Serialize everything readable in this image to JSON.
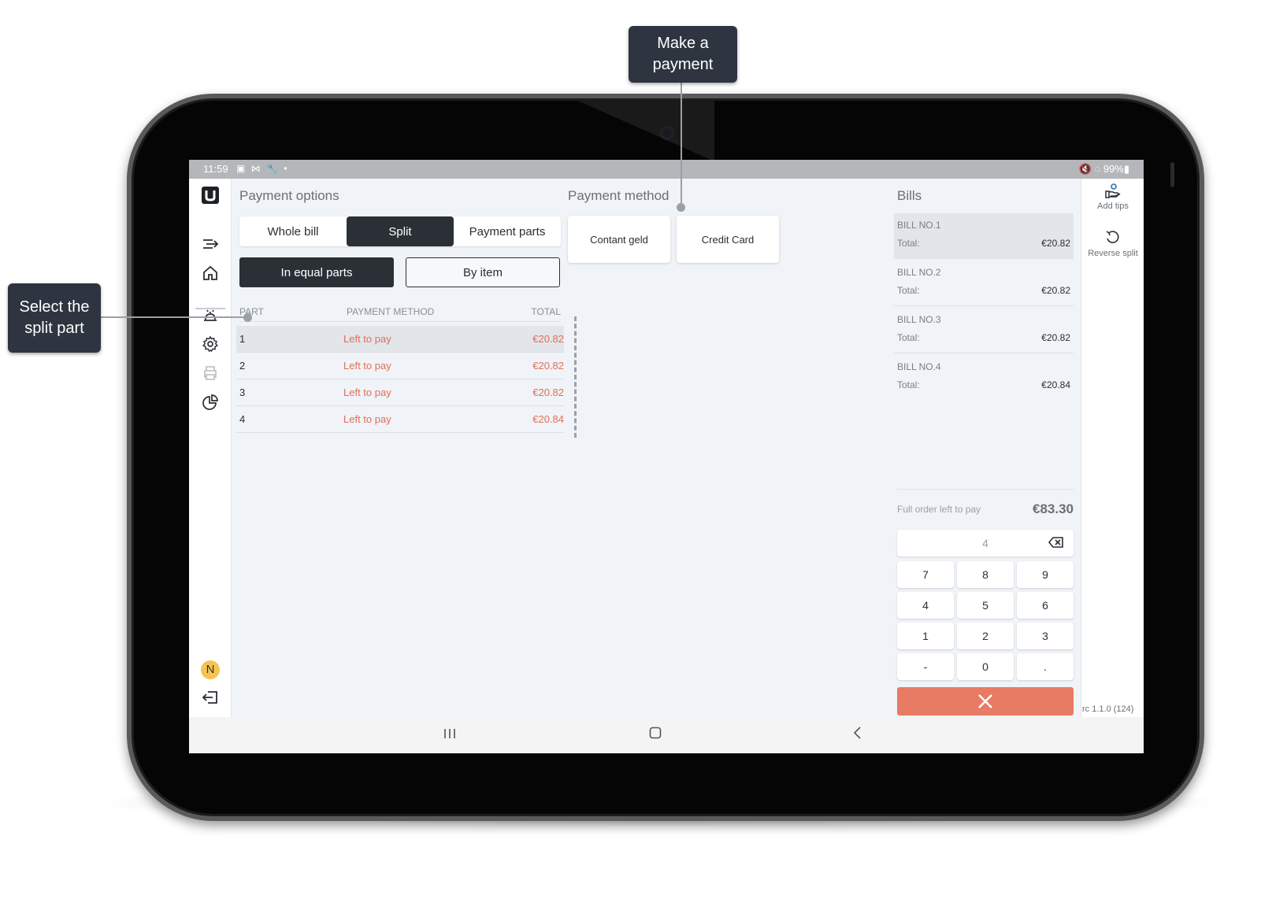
{
  "statusbar": {
    "time": "11:59",
    "left_icons": "▣ ⋈ 🔧 •",
    "right": "🔇 ◌ 99%▮"
  },
  "nav": {
    "icons": [
      "logo-icon",
      "collapse-icon",
      "home-icon",
      "service-bell-icon",
      "settings-icon",
      "print-icon",
      "reports-icon",
      "logout-icon"
    ],
    "avatar_initial": "N"
  },
  "payment_options": {
    "title": "Payment options",
    "tabs": [
      {
        "label": "Whole bill",
        "active": false
      },
      {
        "label": "Split",
        "active": true
      },
      {
        "label": "Payment parts",
        "active": false
      }
    ],
    "split_modes": {
      "equal": "In equal parts",
      "by_item": "By item"
    },
    "table": {
      "headers": {
        "part": "PART",
        "method": "PAYMENT METHOD",
        "total": "TOTAL"
      },
      "rows": [
        {
          "part": "1",
          "method": "Left to pay",
          "total": "€20.82",
          "selected": true
        },
        {
          "part": "2",
          "method": "Left to pay",
          "total": "€20.82",
          "selected": false
        },
        {
          "part": "3",
          "method": "Left to pay",
          "total": "€20.82",
          "selected": false
        },
        {
          "part": "4",
          "method": "Left to pay",
          "total": "€20.84",
          "selected": false
        }
      ]
    }
  },
  "payment_method": {
    "title": "Payment method",
    "methods": [
      "Contant geld",
      "Credit Card"
    ]
  },
  "bills": {
    "title": "Bills",
    "total_label": "Total:",
    "items": [
      {
        "name": "BILL NO.1",
        "total": "€20.82",
        "selected": true
      },
      {
        "name": "BILL NO.2",
        "total": "€20.82",
        "selected": false
      },
      {
        "name": "BILL NO.3",
        "total": "€20.82",
        "selected": false
      },
      {
        "name": "BILL NO.4",
        "total": "€20.84",
        "selected": false
      }
    ],
    "full_order_label": "Full order left to pay",
    "full_order_value": "€83.30"
  },
  "keypad": {
    "display_value": "4",
    "keys": [
      "7",
      "8",
      "9",
      "4",
      "5",
      "6",
      "1",
      "2",
      "3",
      "-",
      "0",
      "."
    ]
  },
  "right_rail": {
    "add_tips": "Add tips",
    "reverse_split": "Reverse split",
    "version": "rc 1.1.0 (124)"
  },
  "callouts": {
    "make_payment": [
      "Make a",
      "payment"
    ],
    "select_part": [
      "Select the",
      "split part"
    ]
  },
  "colors": {
    "accent_dark": "#2b3037",
    "due_red": "#e07057",
    "cancel": "#e87b63",
    "callout": "#2e3540"
  }
}
